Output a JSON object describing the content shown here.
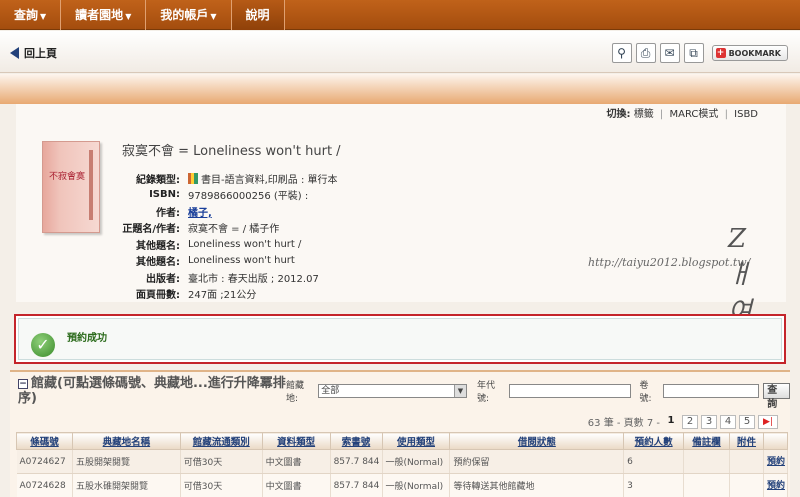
{
  "nav": {
    "items": [
      {
        "label": "查詢",
        "caret": "▼"
      },
      {
        "label": "讀者園地",
        "caret": "▼"
      },
      {
        "label": "我的帳戶",
        "caret": "▼"
      },
      {
        "label": "說明",
        "caret": ""
      }
    ]
  },
  "toolbar": {
    "back_label": "回上頁",
    "bookmark_label": "BOOKMARK"
  },
  "record": {
    "switch_label": "切換:",
    "switch_options": [
      "標籤",
      "MARC模式",
      "ISBD"
    ],
    "title": "寂寞不會 = Loneliness won't hurt /",
    "cover_text": "不寂會寞",
    "fields": [
      {
        "label": "紀錄類型:",
        "value": "書目-語言資料,印刷品 : 單行本"
      },
      {
        "label": "ISBN:",
        "value": "9789866000256 (平裝) :"
      },
      {
        "label": "作者:",
        "value": "橘子,"
      },
      {
        "label": "正題名/作者:",
        "value": "寂寞不會 = / 橘子作"
      },
      {
        "label": "其他題名:",
        "value": "Loneliness won't hurt /"
      },
      {
        "label": "其他題名:",
        "value": "Loneliness won't hurt"
      },
      {
        "label": "出版者:",
        "value": "臺北市 : 春天出版 ; 2012.07"
      },
      {
        "label": "面頁冊數:",
        "value": "247面 ;21公分"
      }
    ]
  },
  "watermark": {
    "text": "http://taiyu2012.blogspot.tw/",
    "signature": "Zㅐ여"
  },
  "success": {
    "message": "預約成功"
  },
  "holdings": {
    "heading": "館藏(可點選條碼號、典藏地...進行升降冪排序)",
    "location_label": "館藏地:",
    "location_value": "全部",
    "year_label": "年代號:",
    "volume_label": "卷號:",
    "search_button": "查詢",
    "pager": {
      "summary": "63 筆 - 頁數 7 -",
      "pages": [
        "1",
        "2",
        "3",
        "4",
        "5"
      ],
      "current": "1"
    },
    "columns": [
      "條碼號",
      "典藏地名稱",
      "館藏流通類別",
      "資料類型",
      "索書號",
      "使用類型",
      "借閱狀態",
      "預約人數",
      "備註欄",
      "附件",
      ""
    ],
    "rows": [
      [
        "A0724627",
        "五股開架閱覽",
        "可借30天",
        "中文圖書",
        "857.7 844",
        "一般(Normal)",
        "預約保留",
        "6",
        "",
        "",
        "預約"
      ],
      [
        "A0724628",
        "五股水碓開架閱覽",
        "可借30天",
        "中文圖書",
        "857.7 844",
        "一般(Normal)",
        "等待轉送其他館藏地",
        "3",
        "",
        "",
        "預約"
      ]
    ]
  }
}
